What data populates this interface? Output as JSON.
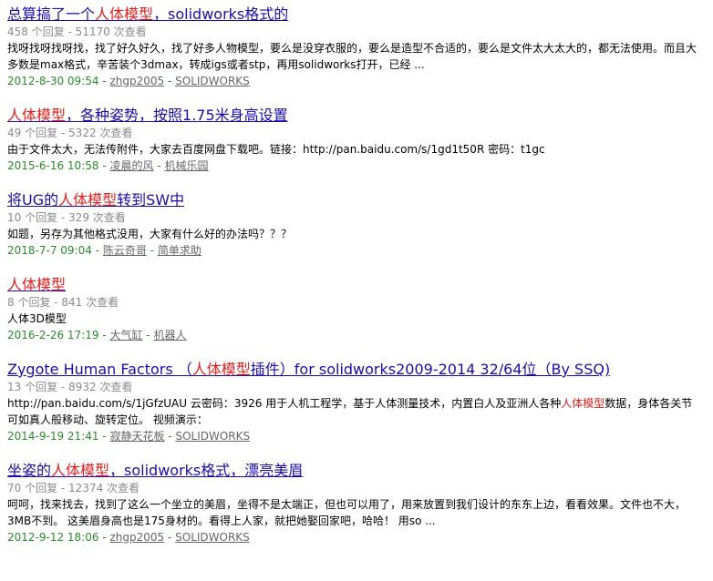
{
  "results": [
    {
      "title": {
        "a": "总算搞了一个",
        "hl": "人体模型",
        "b": "，solidworks格式的"
      },
      "stats": "458 个回复 - 51170 次查看",
      "snippet": {
        "a": "找呀找呀找呀找，找了好久好久，找了好多人物模型，要么是没穿衣服的，要么是造型不合适的，要么是文件太大太大的，都无法使用。而且大多数是max格式，辛苦装个3dmax，转成igs或者stp，再用solidworks打开，已经 ...",
        "hl": "",
        "b": ""
      },
      "date": "2012-8-30 09:54",
      "author": "zhgp2005",
      "forum": "SOLIDWORKS"
    },
    {
      "title": {
        "a": "",
        "hl": "人体模型",
        "b": "，各种姿势，按照1.75米身高设置"
      },
      "stats": "49 个回复 - 5322 次查看",
      "snippet": {
        "a": "由于文件太大，无法传附件，大家去百度网盘下载吧。链接：http://pan.baidu.com/s/1gd1t50R 密码：t1gc",
        "hl": "",
        "b": ""
      },
      "date": "2015-6-16 10:58",
      "author": "凌晨的风",
      "forum": "机械乐园"
    },
    {
      "title": {
        "a": "将UG的",
        "hl": "人体模型",
        "b": "转到SW中"
      },
      "stats": "10 个回复 - 329 次查看",
      "snippet": {
        "a": "如题，另存为其他格式没用，大家有什么好的办法吗？？？",
        "hl": "",
        "b": ""
      },
      "date": "2018-7-7 09:04",
      "author": "陈云奇哥",
      "forum": "简单求助"
    },
    {
      "title": {
        "a": "",
        "hl": "人体模型",
        "b": ""
      },
      "stats": "8 个回复 - 841 次查看",
      "snippet": {
        "a": "人体3D模型",
        "hl": "",
        "b": ""
      },
      "date": "2016-2-26 17:19",
      "author": "大气缸",
      "forum": "机器人"
    },
    {
      "title": {
        "a": "Zygote Human Factors （",
        "hl": "人体模型",
        "b": "插件）for solidworks2009-2014 32/64位（By SSQ)"
      },
      "stats": "13 个回复 - 8932 次查看",
      "snippet": {
        "a": "http://pan.baidu.com/s/1jGfzUAU 云密码：3926 用于人机工程学，基于人体测量技术，内置白人及亚洲人各种",
        "hl": "人体模型",
        "b": "数据，身体各关节可如真人般移动、旋转定位。 视频演示："
      },
      "date": "2014-9-19 21:41",
      "author": "寂静天花板",
      "forum": "SOLIDWORKS"
    },
    {
      "title": {
        "a": "坐姿的",
        "hl": "人体模型",
        "b": "，solidworks格式，漂亮美眉"
      },
      "stats": "70 个回复 - 12374 次查看",
      "snippet": {
        "a": "呵呵，找来找去，找到了这么一个坐立的美眉，坐得不是太端正，但也可以用了，用来放置到我们设计的东东上边，看看效果。文件也不大，3MB不到。 这美眉身高也是175身材的。看得上人家，就把她娶回家吧，哈哈！ 用so ...",
        "hl": "",
        "b": ""
      },
      "date": "2012-9-12 18:06",
      "author": "zhgp2005",
      "forum": "SOLIDWORKS"
    }
  ],
  "colors": {
    "link": "#1a0dab",
    "highlight": "#e0201e",
    "stats": "#8a8a8a",
    "date": "#2b8a2b",
    "meta_link": "#666666"
  }
}
